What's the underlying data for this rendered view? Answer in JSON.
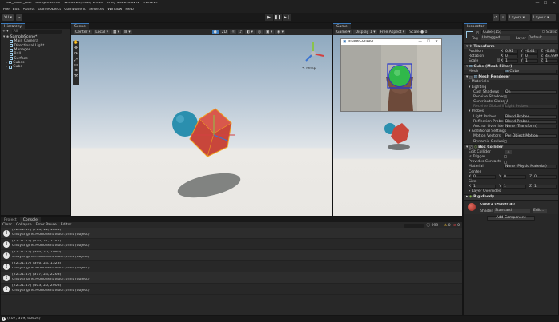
{
  "window": {
    "title": "3D_Color_Ball - SampleScene - Windows, Mac, Linux - Unity 2022.3.62f1* <DX11>",
    "controls": [
      "—",
      "☐",
      "✕"
    ]
  },
  "menu": [
    "File",
    "Edit",
    "Assets",
    "GameObject",
    "Component",
    "Services",
    "Window",
    "Help"
  ],
  "toolbar": {
    "account": "YU",
    "layers": "Layers",
    "layout": "Layout"
  },
  "hierarchy": {
    "tab": "Hierarchy",
    "search_placeholder": "All",
    "scene": "SampleScene*",
    "items": [
      "Main Camera",
      "Directional Light",
      "Manager",
      "Ball",
      "Surface",
      "Cubes",
      "Cube"
    ]
  },
  "scene": {
    "tab": "Scene",
    "center": "Center",
    "local": "Local",
    "mode_2d": "2D",
    "persp": "< Persp"
  },
  "game": {
    "tab": "Game",
    "mode": "Game",
    "display": "Display 1",
    "aspect": "Free Aspect",
    "scale_label": "Scale",
    "scale_value": "0.",
    "popup_title": "ImageContour"
  },
  "console": {
    "tabs": [
      "Project",
      "Console"
    ],
    "buttons": [
      "Clear",
      "Collapse",
      "Error Pause",
      "Editor"
    ],
    "counts": {
      "info": "999+",
      "warn": "0",
      "error": "0"
    },
    "logs": [
      {
        "line1": "[22:51:47] (715, 11, 1864)",
        "line2": "UnityEngine.MonoBehaviour:print (object)"
      },
      {
        "line1": "[22:51:47] (420, 21, 2244)",
        "line2": "UnityEngine.MonoBehaviour:print (object)"
      },
      {
        "line1": "[22:51:47] (396, 20, 1996)",
        "line2": "UnityEngine.MonoBehaviour:print (object)"
      },
      {
        "line1": "[22:51:47] (396, 24, 1323)",
        "line2": "UnityEngine.MonoBehaviour:print (object)"
      },
      {
        "line1": "[22:51:47] (377, 24, 2263)",
        "line2": "UnityEngine.MonoBehaviour:print (object)"
      },
      {
        "line1": "[22:51:47] (403, 26, 2008)",
        "line2": "UnityEngine.MonoBehaviour:print (object)"
      }
    ]
  },
  "inspector": {
    "tab": "Inspector",
    "object_name": "Cube (15)",
    "static": "Static",
    "tag_label": "Tag",
    "tag": "Untagged",
    "layer_label": "Layer",
    "layer": "Default",
    "transform": {
      "title": "Transform",
      "position_label": "Position",
      "rotation_label": "Rotation",
      "scale_label": "Scale",
      "position": {
        "x": "0.92",
        "y": "-0.41",
        "z": "-0.83"
      },
      "rotation": {
        "x": "0",
        "y": "0",
        "z": "44.999"
      },
      "scale": {
        "x": "1",
        "y": "1",
        "z": "1"
      }
    },
    "mesh_filter": {
      "title": "Cube (Mesh Filter)",
      "mesh_label": "Mesh",
      "mesh": "Cube"
    },
    "mesh_renderer": {
      "title": "Mesh Renderer",
      "materials": "Materials",
      "lighting": "Lighting",
      "cast_shadows_label": "Cast Shadows",
      "cast_shadows": "On",
      "receive_shadows": "Receive Shadows",
      "contribute_gi": "Contribute Global I",
      "receive_gi_label": "Receive Global Illu",
      "receive_gi": "Light Probes",
      "probes": "Probes",
      "light_probes_label": "Light Probes",
      "light_probes": "Blend Probes",
      "reflection_probes_label": "Reflection Probes",
      "reflection_probes": "Blend Probes",
      "anchor_override_label": "Anchor Override",
      "anchor_override": "None (Transform)",
      "additional": "Additional Settings",
      "motion_vectors_label": "Motion Vectors",
      "motion_vectors": "Per Object Motion",
      "dynamic_occlusion": "Dynamic Occlusio"
    },
    "box_collider": {
      "title": "Box Collider",
      "edit_collider": "Edit Collider",
      "is_trigger": "Is Trigger",
      "provides_contacts": "Provides Contacts",
      "material_label": "Material",
      "material": "None (Physic Material)",
      "center": "Center",
      "center_v": {
        "x": "0",
        "y": "0",
        "z": "0"
      },
      "size": "Size",
      "size_v": {
        "x": "1",
        "y": "1",
        "z": "1"
      }
    },
    "layer_overrides": "Layer Overrides",
    "rigidbody": "Rigidbody",
    "material_asset": {
      "name": "Color1 (Material)",
      "shader_label": "Shader",
      "shader": "Standard",
      "edit": "Edit..."
    },
    "add_component": "Add Component"
  },
  "status": {
    "text": "(407, 319, 46454)"
  },
  "colors": {
    "accent": "#3a79bb",
    "cube": "#c8463b",
    "ball": "#2b8fae",
    "contour": "#2233cc",
    "detected": "#30b84a"
  }
}
